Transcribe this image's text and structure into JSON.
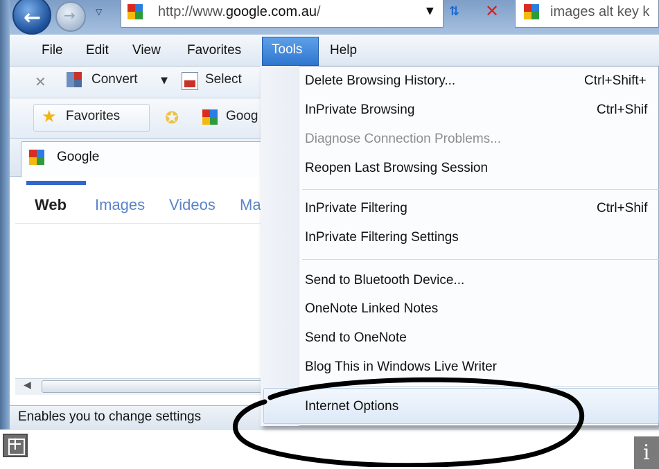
{
  "address_bar": {
    "url_prefix": "http://www.",
    "url_domain": "google.com.au",
    "url_suffix": "/",
    "search_text": "images alt key k"
  },
  "menu_bar": {
    "file": "File",
    "edit": "Edit",
    "view": "View",
    "favorites": "Favorites",
    "tools": "Tools",
    "help": "Help"
  },
  "command_bar": {
    "convert": "Convert",
    "select": "Select"
  },
  "favorites_bar": {
    "favorites": "Favorites",
    "google_link": "Goog"
  },
  "tab": {
    "title": "Google"
  },
  "page": {
    "links": [
      "Web",
      "Images",
      "Videos",
      "Ma"
    ]
  },
  "status_bar": {
    "text": "Enables you to change settings"
  },
  "tools_menu": {
    "items": [
      {
        "label": "Delete Browsing History...",
        "shortcut": "Ctrl+Shift+",
        "enabled": true
      },
      {
        "label": "InPrivate Browsing",
        "shortcut": "Ctrl+Shif",
        "enabled": true
      },
      {
        "label": "Diagnose Connection Problems...",
        "shortcut": "",
        "enabled": false
      },
      {
        "label": "Reopen Last Browsing Session",
        "shortcut": "",
        "enabled": true
      },
      {
        "label": "InPrivate Filtering",
        "shortcut": "Ctrl+Shif",
        "enabled": true
      },
      {
        "label": "InPrivate Filtering Settings",
        "shortcut": "",
        "enabled": true
      },
      {
        "label": "Send to Bluetooth Device...",
        "shortcut": "",
        "enabled": true
      },
      {
        "label": "OneNote Linked Notes",
        "shortcut": "",
        "enabled": true
      },
      {
        "label": "Send to OneNote",
        "shortcut": "",
        "enabled": true
      },
      {
        "label": "Blog This in Windows Live Writer",
        "shortcut": "",
        "enabled": true
      },
      {
        "label": "Internet Options",
        "shortcut": "",
        "enabled": true,
        "highlighted": true
      }
    ]
  },
  "overlay": {
    "expand_symbol": "+",
    "info_symbol": "i"
  },
  "colors": {
    "menu_highlight": "#2f76cf",
    "link_blue": "#5a83c8",
    "annotation": "#000000"
  }
}
